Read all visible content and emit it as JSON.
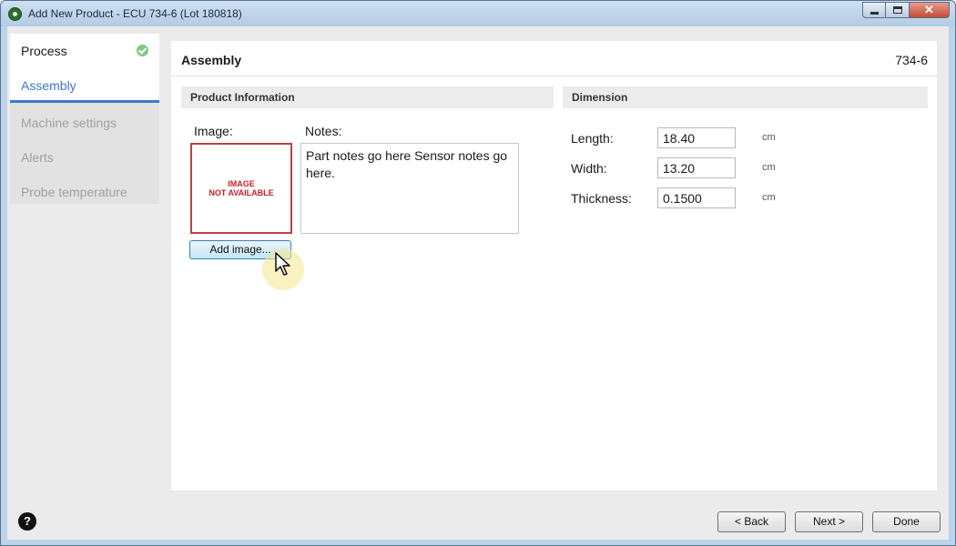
{
  "window": {
    "title": "Add New Product - ECU 734-6 (Lot 180818)",
    "controls": {
      "minimize": "minimize",
      "maximize": "maximize",
      "close": "✕"
    }
  },
  "sidebar": {
    "items": [
      {
        "label": "Process",
        "state": "done",
        "icon": "check-icon"
      },
      {
        "label": "Assembly",
        "state": "active"
      },
      {
        "label": "Machine settings",
        "state": "disabled"
      },
      {
        "label": "Alerts",
        "state": "disabled"
      },
      {
        "label": "Probe temperature",
        "state": "disabled"
      }
    ]
  },
  "panel": {
    "title": "Assembly",
    "code": "734-6",
    "product_info": {
      "heading": "Product Information",
      "image_label": "Image:",
      "image_placeholder": "IMAGE\nNOT AVAILABLE",
      "notes_label": "Notes:",
      "notes_value": "Part notes go here Sensor notes go here.",
      "add_image_label": "Add image..."
    },
    "dimension": {
      "heading": "Dimension",
      "fields": [
        {
          "label": "Length:",
          "value": "18.40",
          "unit": "cm"
        },
        {
          "label": "Width:",
          "value": "13.20",
          "unit": "cm"
        },
        {
          "label": "Thickness:",
          "value": "0.1500",
          "unit": "cm"
        }
      ]
    }
  },
  "footer": {
    "help_label": "?",
    "back_label": "< Back",
    "next_label": "Next >",
    "done_label": "Done"
  },
  "colors": {
    "accent": "#3b7ac6",
    "check": "#7cc984",
    "placeholder_border": "#bd4343",
    "placeholder_text": "#c8202a"
  }
}
